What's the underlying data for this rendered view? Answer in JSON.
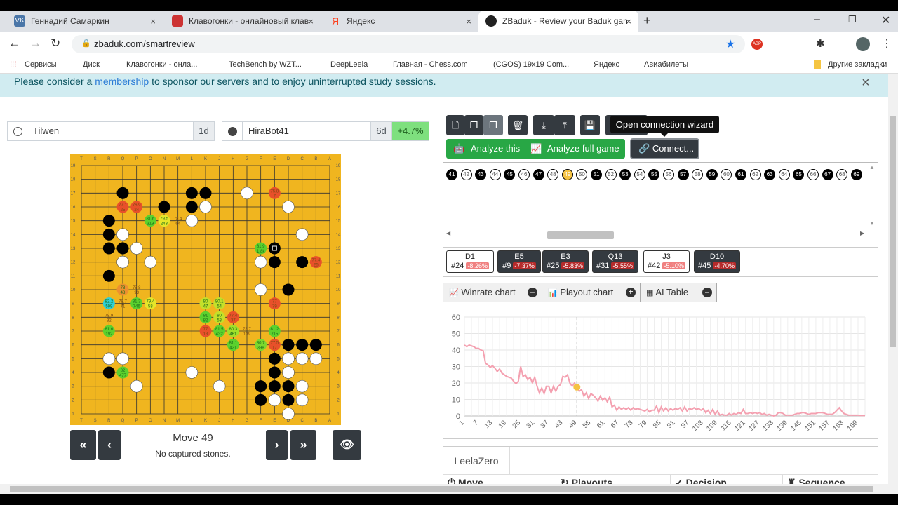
{
  "browser": {
    "tabs": [
      {
        "label": "Геннадий Самаркин",
        "icon": "vk-icon",
        "color": "#4a76a8"
      },
      {
        "label": "Клавогонки - онлайновый клав",
        "icon": "car-icon",
        "color": "#c33"
      },
      {
        "label": "Яндекс",
        "icon": "yandex-icon",
        "color": "#fc3f1d"
      },
      {
        "label": "ZBaduk - Review your Baduk gan",
        "icon": "zbaduk-icon",
        "color": "#222"
      }
    ],
    "url": "zbaduk.com/smartreview",
    "bookmarks": [
      "Сервисы",
      "Диск",
      "Клавогонки - онла...",
      "TechBench by WZT...",
      "DeepLeela",
      "Главная - Chess.com",
      "(CGOS) 19x19 Com...",
      "Яндекс",
      "Авиабилеты"
    ],
    "other_bookmarks": "Другие закладки"
  },
  "banner": {
    "pre": "Please consider a ",
    "link": "membership",
    "post": " to sponsor our servers and to enjoy uninterrupted study sessions.",
    "close": "×"
  },
  "players": {
    "white": {
      "name": "Tilwen",
      "rank": "1d"
    },
    "black": {
      "name": "HiraBot41",
      "rank": "6d",
      "score": "+4.7%"
    }
  },
  "board": {
    "columns": [
      "T",
      "S",
      "R",
      "Q",
      "P",
      "O",
      "N",
      "M",
      "L",
      "K",
      "J",
      "H",
      "G",
      "F",
      "E",
      "D",
      "C",
      "B",
      "A"
    ],
    "black": [
      "Q17",
      "L17",
      "K17",
      "N16",
      "L16",
      "R15",
      "R14",
      "R13",
      "Q13",
      "R11",
      "E13",
      "E12",
      "C12",
      "D10",
      "D6",
      "C6",
      "B6",
      "E5",
      "E4",
      "R4",
      "F3",
      "E3",
      "D3",
      "F2",
      "D2"
    ],
    "white": [
      "G17",
      "K16",
      "D16",
      "L15",
      "Q14",
      "C14",
      "P13",
      "Q12",
      "O12",
      "F12",
      "F10",
      "R5",
      "Q5",
      "D5",
      "C5",
      "B5",
      "L4",
      "D4",
      "P3",
      "J3",
      "C3",
      "E2",
      "C2",
      "D1"
    ],
    "last_move": "E13",
    "candidates": [
      {
        "at": "Q16",
        "wr": "77.1",
        "po": "25",
        "c": "#e8502a"
      },
      {
        "at": "P16",
        "wr": "76.9",
        "po": "24",
        "c": "#e8502a"
      },
      {
        "at": "E17",
        "wr": "75.8",
        "po": "7",
        "c": "#e8502a"
      },
      {
        "at": "O15",
        "wr": "81.6",
        "po": "319",
        "c": "#5bd12e"
      },
      {
        "at": "N15",
        "wr": "79.5",
        "po": "243",
        "c": "#e6e62a"
      },
      {
        "at": "M15",
        "wr": "78.4",
        "po": "64",
        "c": ""
      },
      {
        "at": "F13",
        "wr": "81.9",
        "po": "1.8k",
        "c": "#5bd12e"
      },
      {
        "at": "B12",
        "wr": "77.4",
        "po": "25",
        "c": "#e8502a"
      },
      {
        "at": "Q10",
        "wr": "78",
        "po": "48",
        "c": "#ec9030"
      },
      {
        "at": "P10",
        "wr": "78.8",
        "po": "93",
        "c": ""
      },
      {
        "at": "R9",
        "wr": "82.2",
        "po": "599",
        "c": "#2ecfd6"
      },
      {
        "at": "Q9",
        "wr": "78.7",
        "po": "71",
        "c": ""
      },
      {
        "at": "P9",
        "wr": "81.3",
        "po": "746",
        "c": "#5bd12e"
      },
      {
        "at": "O9",
        "wr": "79.4",
        "po": "58",
        "c": "#e6e62a"
      },
      {
        "at": "K9",
        "wr": "80",
        "po": "47",
        "c": "#c4e02a"
      },
      {
        "at": "J9",
        "wr": "80.1",
        "po": "54",
        "c": "#c4e02a"
      },
      {
        "at": "E9",
        "wr": "77",
        "po": "79",
        "c": "#e8502a"
      },
      {
        "at": "R8",
        "wr": "78.9",
        "po": "32",
        "c": ""
      },
      {
        "at": "K8",
        "wr": "81",
        "po": "82",
        "c": "#5bd12e"
      },
      {
        "at": "J8",
        "wr": "80",
        "po": "53",
        "c": "#c4e02a"
      },
      {
        "at": "H8",
        "wr": "77.4",
        "po": "37",
        "c": "#e8502a"
      },
      {
        "at": "R7",
        "wr": "81.6",
        "po": "192",
        "c": "#5bd12e"
      },
      {
        "at": "K7",
        "wr": "77",
        "po": "13",
        "c": "#e8502a"
      },
      {
        "at": "J7",
        "wr": "81.5",
        "po": "432",
        "c": "#5bd12e"
      },
      {
        "at": "H7",
        "wr": "80.3",
        "po": "461",
        "c": "#a0e02a"
      },
      {
        "at": "G7",
        "wr": "78.7",
        "po": "139",
        "c": ""
      },
      {
        "at": "E7",
        "wr": "81.2",
        "po": "715",
        "c": "#5bd12e"
      },
      {
        "at": "H6",
        "wr": "81.1",
        "po": "421",
        "c": "#5bd12e"
      },
      {
        "at": "F6",
        "wr": "80.7",
        "po": "398",
        "c": "#7bd82e"
      },
      {
        "at": "E6",
        "wr": "77.5",
        "po": "17",
        "c": "#e8502a"
      },
      {
        "at": "Q4",
        "wr": "82",
        "po": "477",
        "c": "#5bd12e"
      }
    ]
  },
  "controls": {
    "move_label": "Move 49",
    "captures": "No captured stones.",
    "first": "«",
    "prev": "‹",
    "next": "›",
    "last": "»"
  },
  "toolbar": {
    "tooltip": "Open connection wizard",
    "analyze_this": "Analyze this",
    "analyze_full": "Analyze full game",
    "connect": "Connect..."
  },
  "movelist": {
    "first": 41,
    "last": 69,
    "current": 49
  },
  "mistakes": [
    {
      "coord": "D1",
      "num": "#24",
      "pct": "-8.26%",
      "color": "white"
    },
    {
      "coord": "E5",
      "num": "#9",
      "pct": "-7.37%",
      "color": "black"
    },
    {
      "coord": "E3",
      "num": "#25",
      "pct": "-5.83%",
      "color": "black"
    },
    {
      "coord": "Q13",
      "num": "#31",
      "pct": "-5.55%",
      "color": "black"
    },
    {
      "coord": "J3",
      "num": "#42",
      "pct": "-5.10%",
      "color": "white"
    },
    {
      "coord": "D10",
      "num": "#45",
      "pct": "-4.70%",
      "color": "black"
    }
  ],
  "chart_tabs": [
    {
      "label": "Winrate chart",
      "state": "minus"
    },
    {
      "label": "Playout chart",
      "state": "plus"
    },
    {
      "label": "AI Table",
      "state": "minus"
    }
  ],
  "chart_data": {
    "type": "line",
    "ylim": [
      0,
      60
    ],
    "yticks": [
      "0",
      "10",
      "20",
      "30",
      "40",
      "50",
      "60"
    ],
    "xticks": [
      "1",
      "7",
      "13",
      "19",
      "25",
      "31",
      "37",
      "43",
      "49",
      "55",
      "61",
      "67",
      "73",
      "79",
      "85",
      "91",
      "97",
      "103",
      "109",
      "115",
      "121",
      "127",
      "133",
      "139",
      "145",
      "151",
      "157",
      "163",
      "169"
    ],
    "current_move": 49,
    "line_color": "#f4a0b0",
    "marker_color": "#f5c242",
    "values": [
      43,
      42,
      43,
      42.5,
      42,
      41,
      41,
      40,
      39.5,
      32,
      31,
      29.5,
      30.5,
      29,
      27,
      28.5,
      26,
      25,
      24,
      23.5,
      23,
      21,
      19.5,
      21,
      30,
      24,
      25,
      22,
      23.5,
      20,
      23.5,
      18,
      14,
      17,
      13.5,
      18,
      18,
      14,
      18,
      15,
      18,
      19,
      24,
      23.5,
      25,
      20,
      18,
      20,
      17.5,
      15,
      16,
      12,
      14,
      10.5,
      13.5,
      12.5,
      11,
      9,
      12,
      9.5,
      11,
      8.5,
      11.5,
      5.5,
      6.5,
      3.5,
      5.5,
      4,
      5,
      4,
      5,
      3.5,
      5,
      4,
      4.5,
      4,
      3.5,
      3,
      4,
      2.5,
      3.5,
      3.5,
      6,
      2,
      5.5,
      3,
      5,
      3,
      4.5,
      3.5,
      4.5,
      4,
      5,
      3,
      5.5,
      3,
      4.5,
      4,
      5,
      4,
      4.5,
      3.5,
      4.5,
      2,
      3.5,
      1.5,
      4,
      1,
      3,
      0.5,
      1,
      0.5,
      0.5,
      1.5,
      0.5,
      1.5,
      1,
      2,
      1.5,
      4,
      1.5,
      1.5,
      2,
      1.5,
      2,
      1.5,
      2,
      1,
      1.5,
      0.5,
      1,
      0.5,
      0,
      0.5,
      2,
      2,
      1.5,
      0.5,
      0.5,
      0.5,
      0.5,
      1,
      1.5,
      1.5,
      2,
      2,
      1.5,
      1,
      1.5,
      1.5,
      1.5,
      2,
      2,
      2,
      1.5,
      1,
      1,
      1,
      2,
      3.5,
      5,
      3,
      1.5,
      1,
      0.5,
      0.5,
      0.5,
      0.5,
      0.5,
      0.3,
      0.3,
      0.3
    ]
  },
  "engine": {
    "tab": "LeelaZero",
    "columns": [
      "Move",
      "Playouts",
      "Decision",
      "Sequence"
    ]
  }
}
